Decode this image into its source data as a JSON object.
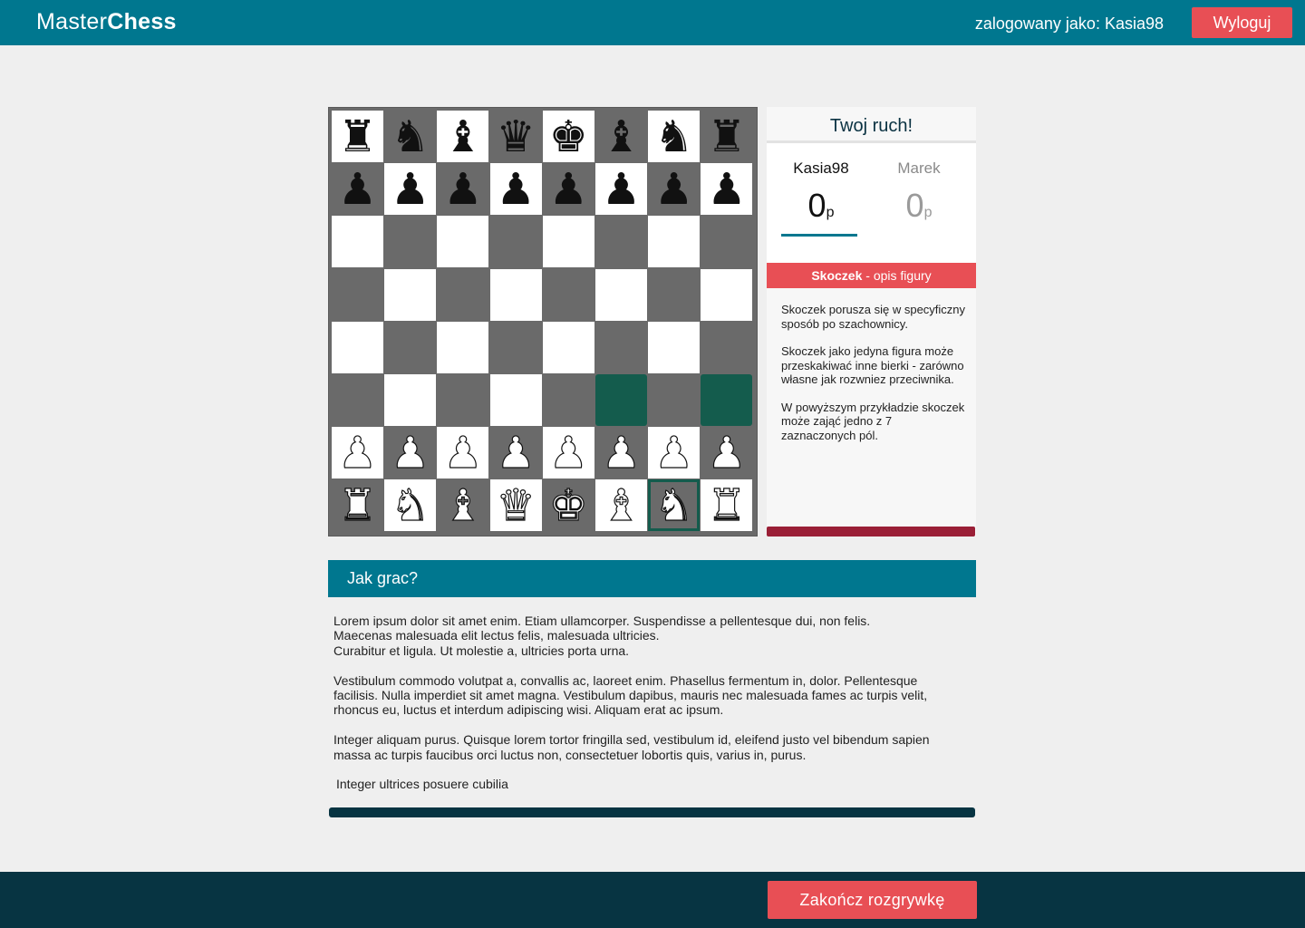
{
  "header": {
    "logo_light": "Master",
    "logo_bold": "Chess",
    "user_info": "zalogowany jako: Kasia98",
    "logout_label": "Wyloguj",
    "color": "#00778f"
  },
  "board": {
    "rows": [
      [
        "bR",
        "bN",
        "bB",
        "bQ",
        "bK",
        "bB",
        "bN",
        "bR"
      ],
      [
        "bP",
        "bP",
        "bP",
        "bP",
        "bP",
        "bP",
        "bP",
        "bP"
      ],
      [
        "",
        "",
        "",
        "",
        "",
        "",
        "",
        ""
      ],
      [
        "",
        "",
        "",
        "",
        "",
        "",
        "",
        ""
      ],
      [
        "",
        "",
        "",
        "",
        "",
        "",
        "",
        ""
      ],
      [
        "",
        "",
        "",
        "",
        "",
        "",
        "",
        ""
      ],
      [
        "wP",
        "wP",
        "wP",
        "wP",
        "wP",
        "wP",
        "wP",
        "wP"
      ],
      [
        "wR",
        "wN",
        "wB",
        "wQ",
        "wK",
        "wB",
        "wN",
        "wR"
      ]
    ],
    "highlighted": [
      [
        5,
        5
      ],
      [
        5,
        7
      ]
    ],
    "selected": [
      7,
      6
    ],
    "colors": {
      "light": "#ffffff",
      "dark": "#6a6a6a",
      "highlight": "#145c4d"
    }
  },
  "panel": {
    "turn": "Twoj ruch!",
    "player1": {
      "name": "Kasia98",
      "score": "0",
      "unit": "p"
    },
    "player2": {
      "name": "Marek",
      "score": "0",
      "unit": "p"
    },
    "desc_title": "Skoczek",
    "desc_sub": " - opis figury",
    "desc": [
      "Skoczek porusza się w specyficzny sposób po szachownicy.",
      "Skoczek jako jedyna figura może przeskakiwać inne bierki - zarówno własne jak rozwniez przeciwnika.",
      "W powyższym przykładzie skoczek może zająć jedno z 7 zaznaczonych pól."
    ]
  },
  "howto": {
    "title": "Jak grac?",
    "paragraphs": [
      "Lorem ipsum dolor sit amet enim. Etiam ullamcorper. Suspendisse a pellentesque dui, non felis. Maecenas malesuada elit lectus felis, malesuada ultricies.\nCurabitur et ligula. Ut molestie a, ultricies porta urna.",
      "Vestibulum commodo volutpat a, convallis ac, laoreet enim. Phasellus fermentum in, dolor. Pellentesque facilisis. Nulla imperdiet sit amet magna. Vestibulum dapibus, mauris nec malesuada fames ac turpis velit, rhoncus eu, luctus et interdum adipiscing wisi. Aliquam erat ac ipsum.",
      "Integer aliquam purus. Quisque lorem tortor fringilla sed, vestibulum id, eleifend justo vel bibendum sapien massa ac turpis faucibus orci luctus non, consectetuer lobortis quis, varius in, purus.",
      "Integer ultrices posuere cubilia"
    ]
  },
  "footer": {
    "end_label": "Zakończ rozgrywkę"
  }
}
